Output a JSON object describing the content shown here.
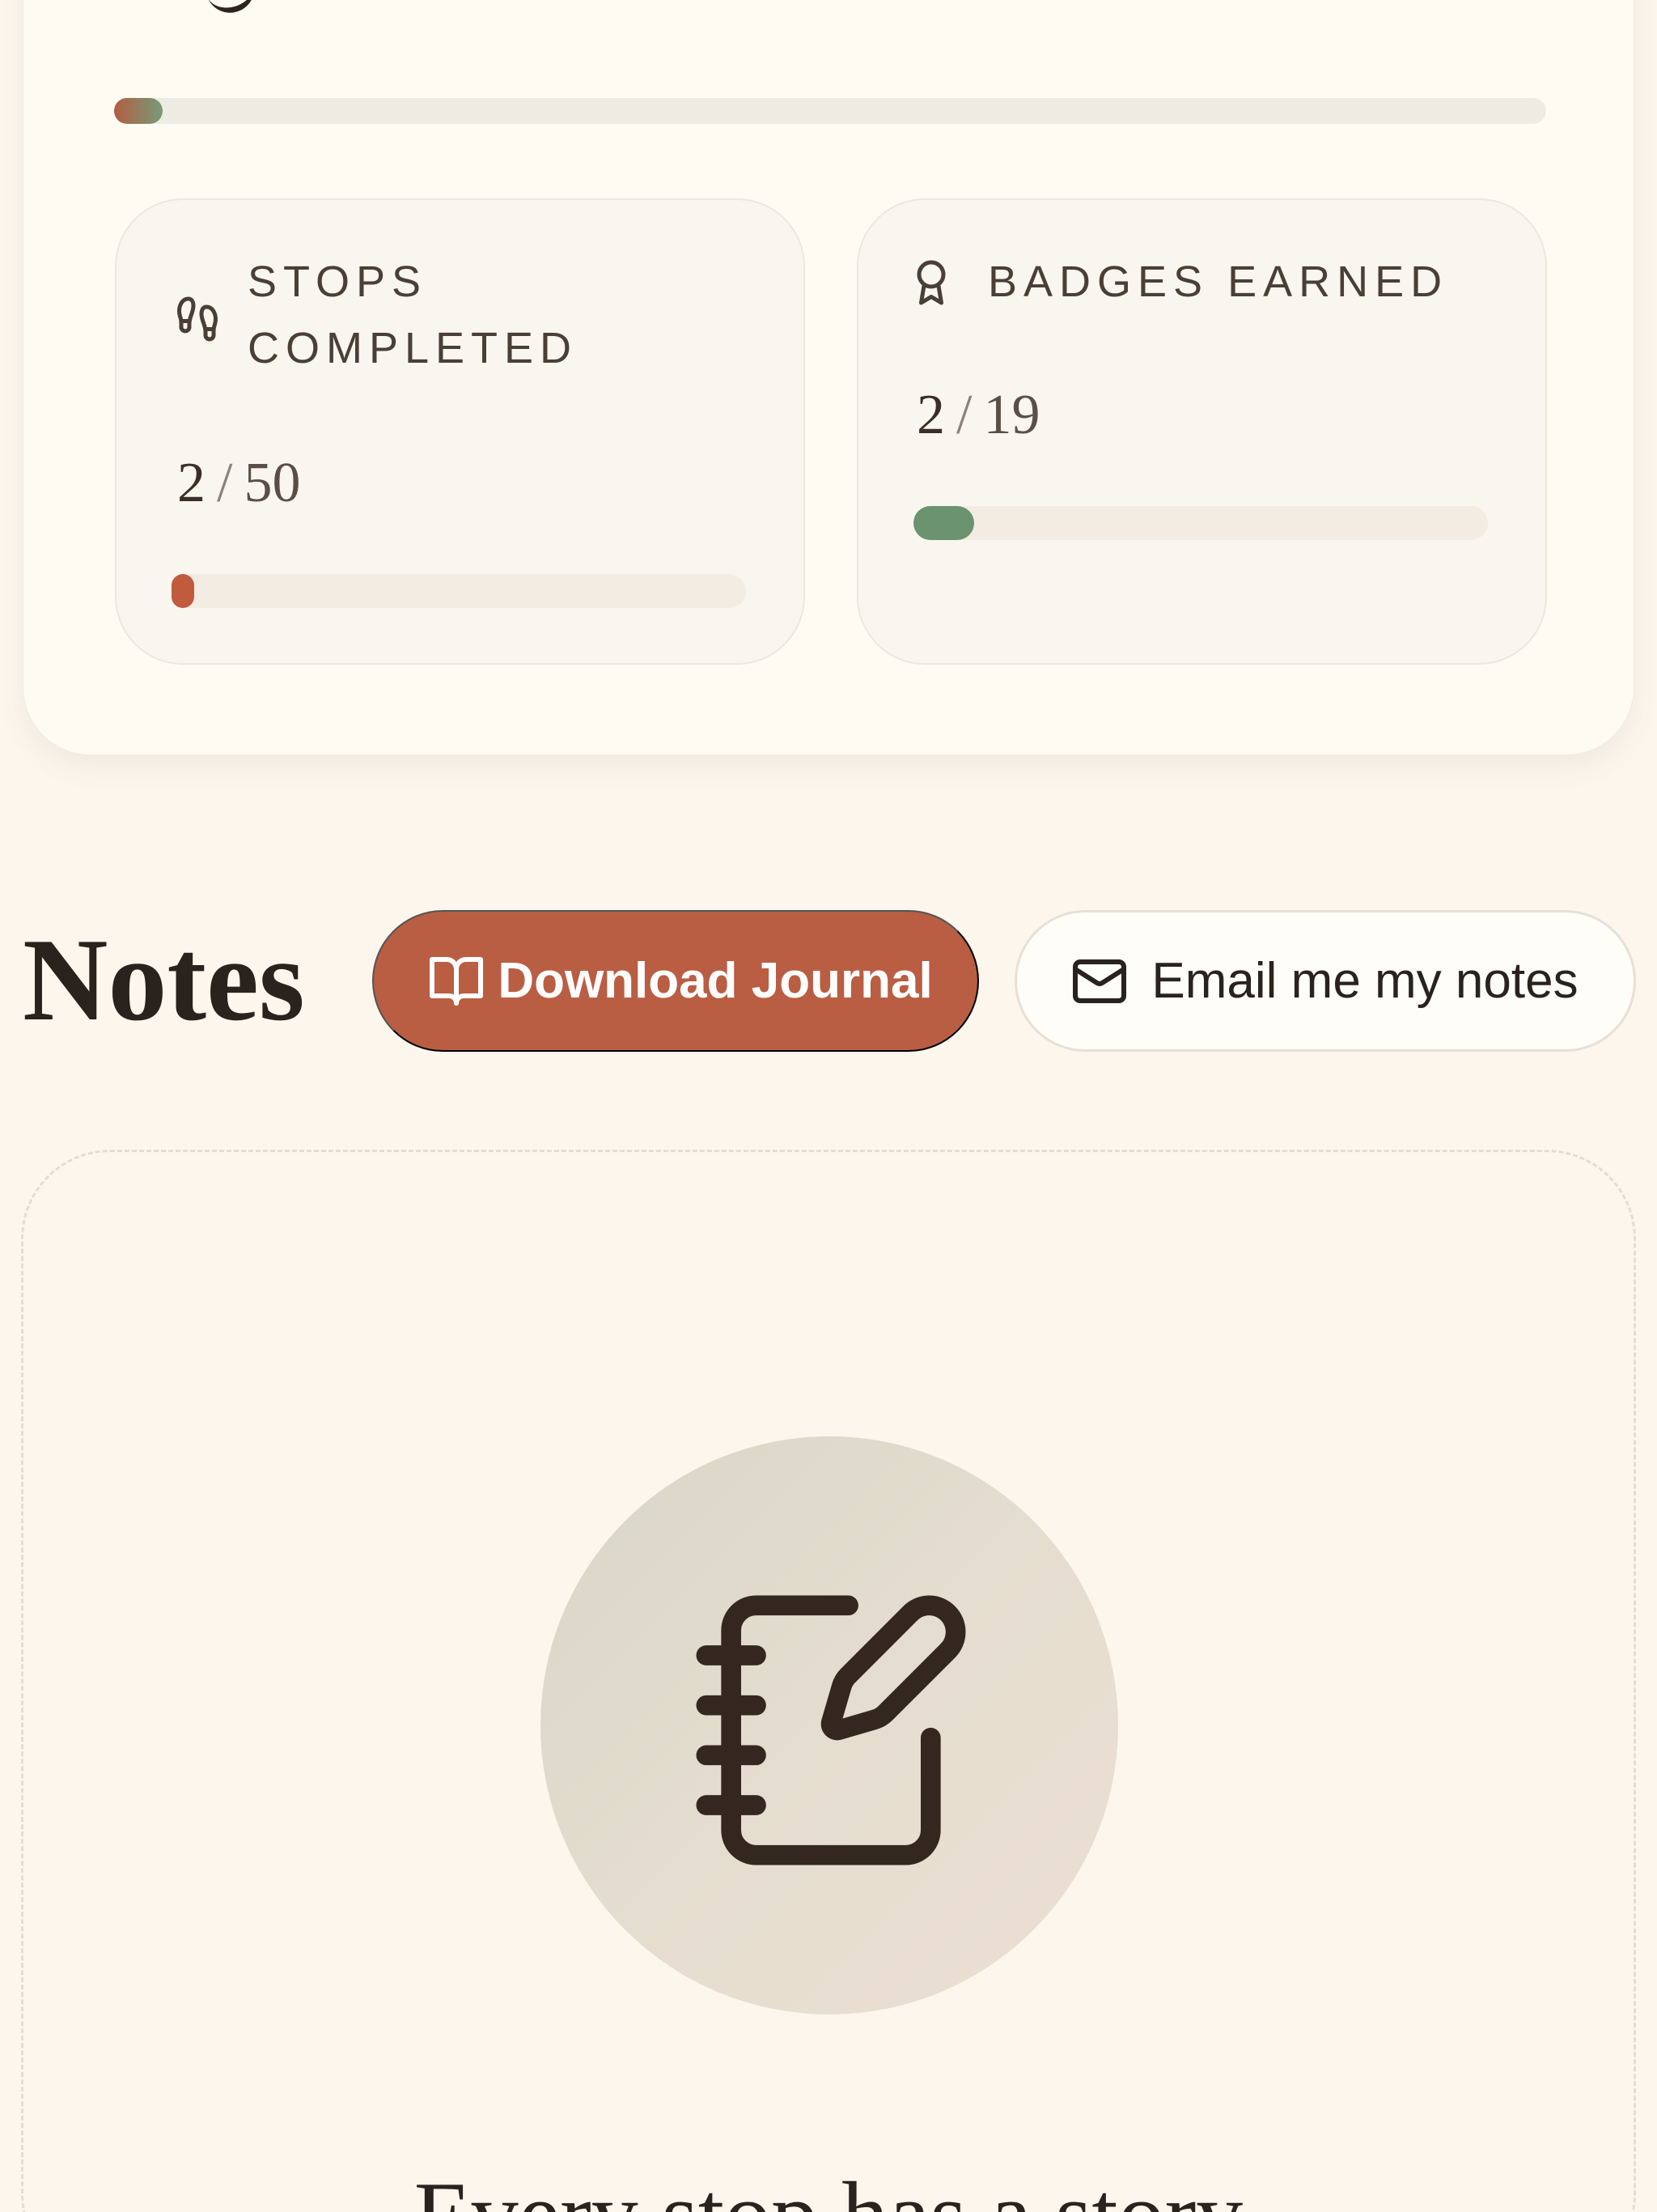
{
  "progress": {
    "overall_fraction": 0.034,
    "stops": {
      "label": "STOPS COMPLETED",
      "completed": "2",
      "separator": "/",
      "total": "50",
      "fraction": 0.04,
      "fill_color": "#c05b3e",
      "icon": "footprints-icon"
    },
    "badges": {
      "label": "BADGES EARNED",
      "completed": "2",
      "separator": "/",
      "total": "19",
      "fraction": 0.105,
      "fill_color": "#6b9370",
      "icon": "award-icon"
    }
  },
  "notes": {
    "title": "Notes",
    "download_button": {
      "label": "Download Journal",
      "icon": "book-open-icon"
    },
    "email_button": {
      "label": "Email me my notes",
      "icon": "mail-icon"
    },
    "empty_state": {
      "icon": "notebook-pen-icon",
      "text": "Every stop has a story"
    }
  },
  "colors": {
    "background": "#fcf6ed",
    "accent": "#b95e43",
    "sage": "#6b9370",
    "ink": "#2e241d"
  }
}
